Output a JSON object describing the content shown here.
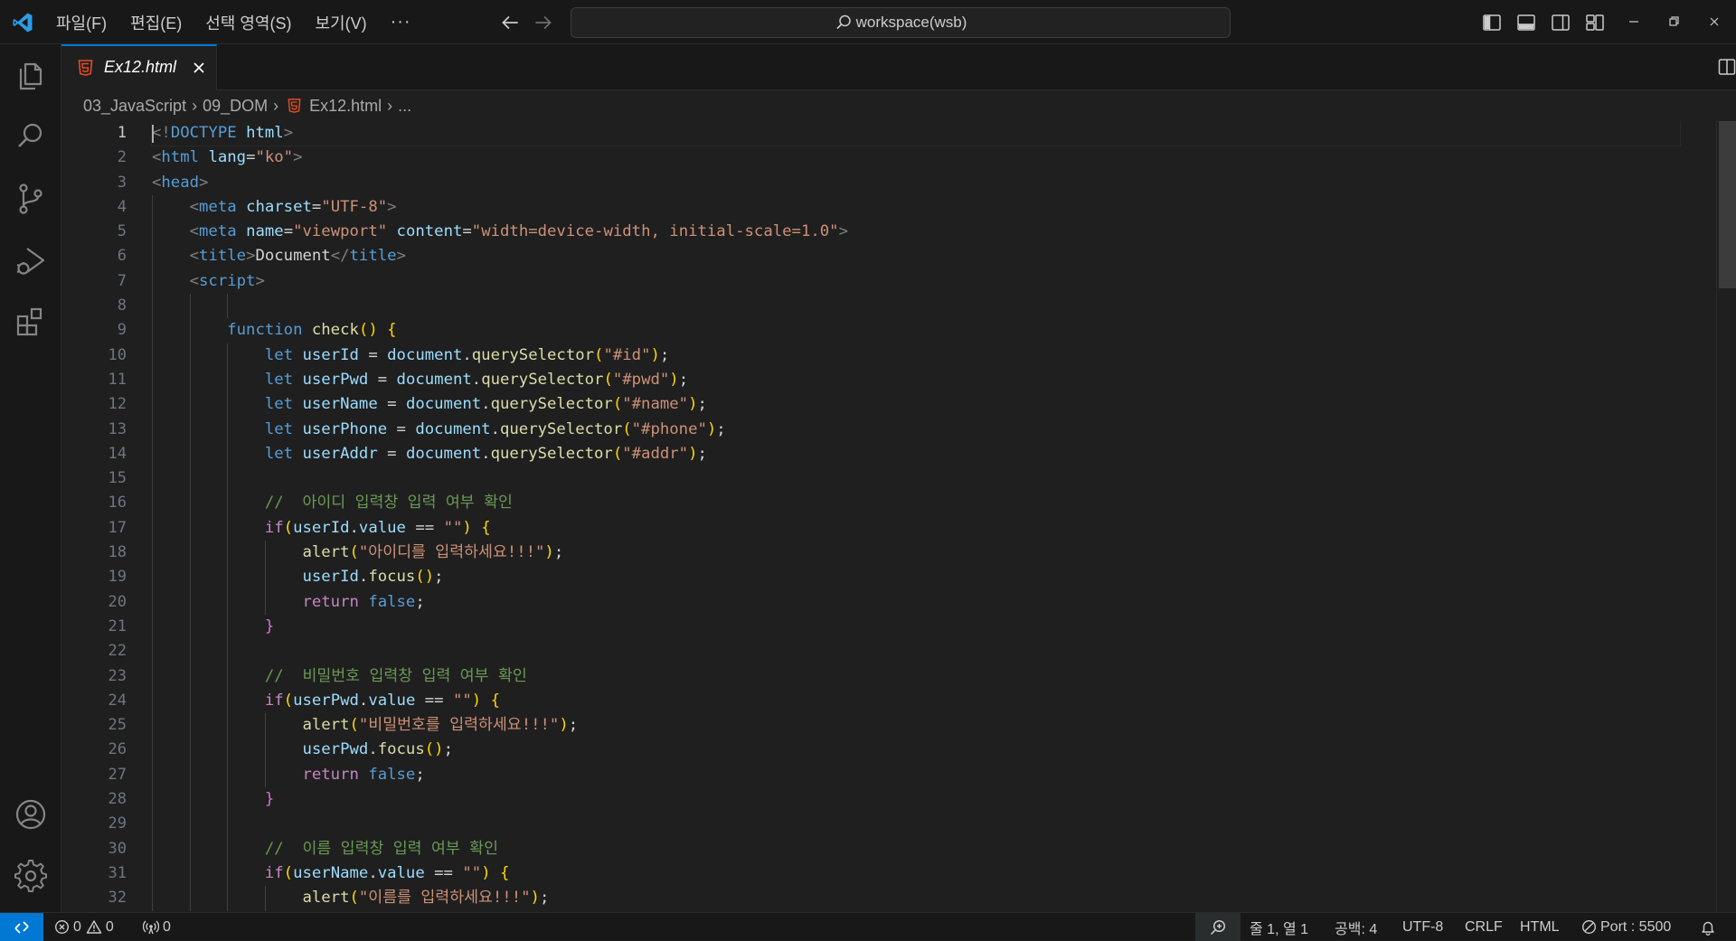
{
  "titlebar": {
    "menu": [
      "파일(F)",
      "편집(E)",
      "선택 영역(S)",
      "보기(V)"
    ],
    "more": "···",
    "search_text": "workspace(wsb)"
  },
  "tab": {
    "label": "Ex12.html",
    "icon": "html5-icon"
  },
  "breadcrumb": [
    "03_JavaScript",
    "09_DOM",
    "Ex12.html",
    "..."
  ],
  "editor": {
    "current_line": 1,
    "line_numbers": [
      "1",
      "2",
      "3",
      "4",
      "5",
      "6",
      "7",
      "8",
      "9",
      "10",
      "11",
      "12",
      "13",
      "14",
      "15",
      "16",
      "17",
      "18",
      "19",
      "20",
      "21",
      "22",
      "23",
      "24",
      "25",
      "26",
      "27",
      "28",
      "29",
      "30",
      "31",
      "32"
    ],
    "lines": [
      "<!DOCTYPE html>",
      "<html lang=\"ko\">",
      "<head>",
      "    <meta charset=\"UTF-8\">",
      "    <meta name=\"viewport\" content=\"width=device-width, initial-scale=1.0\">",
      "    <title>Document</title>",
      "    <script>",
      "",
      "        function check() {",
      "            let userId = document.querySelector(\"#id\");",
      "            let userPwd = document.querySelector(\"#pwd\");",
      "            let userName = document.querySelector(\"#name\");",
      "            let userPhone = document.querySelector(\"#phone\");",
      "            let userAddr = document.querySelector(\"#addr\");",
      "",
      "            //  아이디 입력창 입력 여부 확인",
      "            if(userId.value == \"\") {",
      "                alert(\"아이디를 입력하세요!!!\");",
      "                userId.focus();",
      "                return false;",
      "            }",
      "",
      "            //  비밀번호 입력창 입력 여부 확인",
      "            if(userPwd.value == \"\") {",
      "                alert(\"비밀번호를 입력하세요!!!\");",
      "                userPwd.focus();",
      "                return false;",
      "            }",
      "",
      "            //  이름 입력창 입력 여부 확인",
      "            if(userName.value == \"\") {",
      "                alert(\"이름를 입력하세요!!!\");"
    ]
  },
  "statusbar": {
    "errors": "0",
    "warnings": "0",
    "ports": "0",
    "position": "줄 1, 열 1",
    "spaces": "공백: 4",
    "encoding": "UTF-8",
    "eol": "CRLF",
    "language": "HTML",
    "port": "Port : 5500"
  },
  "colors": {
    "accent": "#0078d4",
    "html_icon": "#e44d26"
  }
}
